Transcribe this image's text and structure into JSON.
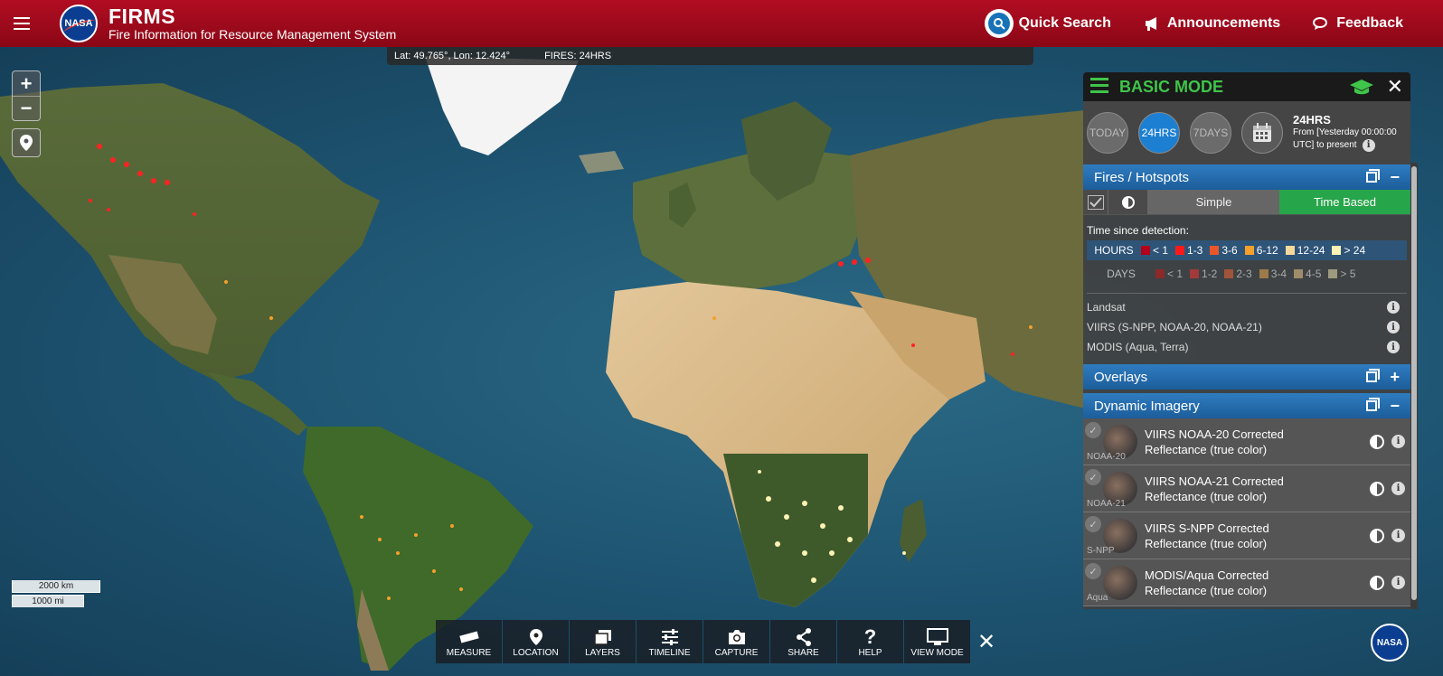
{
  "header": {
    "logo_text": "NASA",
    "title": "FIRMS",
    "subtitle": "Fire Information for Resource Management System",
    "quick_search": "Quick Search",
    "announcements": "Announcements",
    "feedback": "Feedback"
  },
  "status": {
    "coords": "Lat: 49.765°, Lon: 12.424°",
    "fires": "FIRES: 24HRS"
  },
  "map_controls": {
    "zoom_in": "+",
    "zoom_out": "−",
    "scale_km": "2000 km",
    "scale_mi": "1000 mi"
  },
  "toolbar": {
    "items": [
      {
        "label": "MEASURE",
        "icon": "ruler-icon"
      },
      {
        "label": "LOCATION",
        "icon": "location-pin-icon"
      },
      {
        "label": "LAYERS",
        "icon": "layers-icon"
      },
      {
        "label": "TIMELINE",
        "icon": "sliders-icon"
      },
      {
        "label": "CAPTURE",
        "icon": "camera-icon"
      },
      {
        "label": "SHARE",
        "icon": "share-icon"
      },
      {
        "label": "HELP",
        "icon": "question-icon"
      },
      {
        "label": "VIEW MODE",
        "icon": "monitor-icon"
      }
    ],
    "close": "✕"
  },
  "panel": {
    "mode": "BASIC MODE",
    "time_buttons": [
      "TODAY",
      "24HRS",
      "7DAYS"
    ],
    "active_time": "24HRS",
    "time_title": "24HRS",
    "time_line1": "From [Yesterday 00:00:00",
    "time_line2": "UTC] to present",
    "fires_section": "Fires / Hotspots",
    "view_simple": "Simple",
    "view_time": "Time Based",
    "legend_label": "Time since detection:",
    "hours_label": "HOURS",
    "hours": [
      {
        "label": "< 1",
        "color": "#b3001b"
      },
      {
        "label": "1-3",
        "color": "#ff1a1a"
      },
      {
        "label": "3-6",
        "color": "#e8562a"
      },
      {
        "label": "6-12",
        "color": "#f5a02a"
      },
      {
        "label": "12-24",
        "color": "#f6d89c"
      },
      {
        "label": "> 24",
        "color": "#fbf2b4"
      }
    ],
    "days_label": "DAYS",
    "days": [
      {
        "label": "< 1",
        "color": "#8c2a2a"
      },
      {
        "label": "1-2",
        "color": "#a33a3a"
      },
      {
        "label": "2-3",
        "color": "#a0553a"
      },
      {
        "label": "3-4",
        "color": "#9c7a4a"
      },
      {
        "label": "4-5",
        "color": "#a08c6a"
      },
      {
        "label": "> 5",
        "color": "#9e9a80"
      }
    ],
    "sensors": [
      "Landsat",
      "VIIRS (S-NPP, NOAA-20, NOAA-21)",
      "MODIS (Aqua, Terra)"
    ],
    "overlays_section": "Overlays",
    "dynamic_section": "Dynamic Imagery",
    "imagery": [
      {
        "sat": "NOAA-20",
        "line1": "VIIRS NOAA-20 Corrected",
        "line2": "Reflectance (true color)"
      },
      {
        "sat": "NOAA-21",
        "line1": "VIIRS NOAA-21 Corrected",
        "line2": "Reflectance (true color)"
      },
      {
        "sat": "S-NPP",
        "line1": "VIIRS S-NPP Corrected",
        "line2": "Reflectance (true color)"
      },
      {
        "sat": "Aqua",
        "line1": "MODIS/Aqua Corrected",
        "line2": "Reflectance (true color)"
      }
    ]
  },
  "colors": {
    "header_red": "#a50b1e",
    "accent_green": "#3fc54a",
    "accent_blue": "#1d7fd1"
  }
}
